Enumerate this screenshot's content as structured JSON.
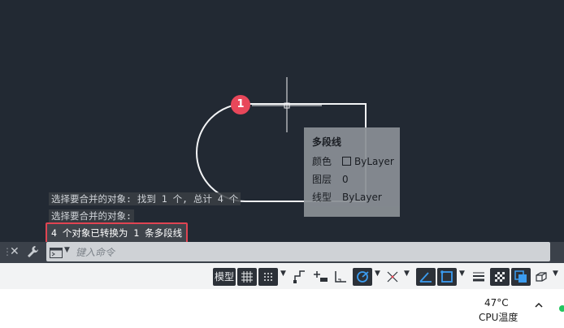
{
  "badge": {
    "number": "1",
    "color": "#e8475a"
  },
  "tooltip": {
    "title": "多段线",
    "rows": [
      {
        "label": "颜色",
        "value": "ByLayer",
        "has_swatch": true
      },
      {
        "label": "图层",
        "value": "0",
        "has_swatch": false
      },
      {
        "label": "线型",
        "value": "ByLayer",
        "has_swatch": false
      }
    ]
  },
  "history": {
    "line1": "选择要合并的对象: 找到 1 个, 总计 4 个",
    "line2": "选择要合并的对象:",
    "line3": "4 个对象已转换为 1 条多段线"
  },
  "command": {
    "placeholder": "键入命令",
    "icons": [
      "close-icon",
      "wrench-icon",
      "command-prompt-icon",
      "dropdown-arrow-icon"
    ]
  },
  "statusbar": {
    "model_label": "模型",
    "icons": [
      "grid-icon",
      "snap-icon",
      "infer-constraints-icon",
      "dynamic-input-icon",
      "ortho-icon",
      "polar-tracking-icon",
      "isodraft-icon",
      "object-snap-tracking-icon",
      "object-snap-icon",
      "lineweight-icon",
      "transparency-icon",
      "selection-cycling-icon",
      "3d-osnap-icon"
    ]
  },
  "taskbar": {
    "temperature": "47°C",
    "cpu_label": "CPU温度"
  },
  "colors": {
    "canvas": "#222933",
    "highlight_border": "#e04452",
    "badge": "#e8475a"
  }
}
